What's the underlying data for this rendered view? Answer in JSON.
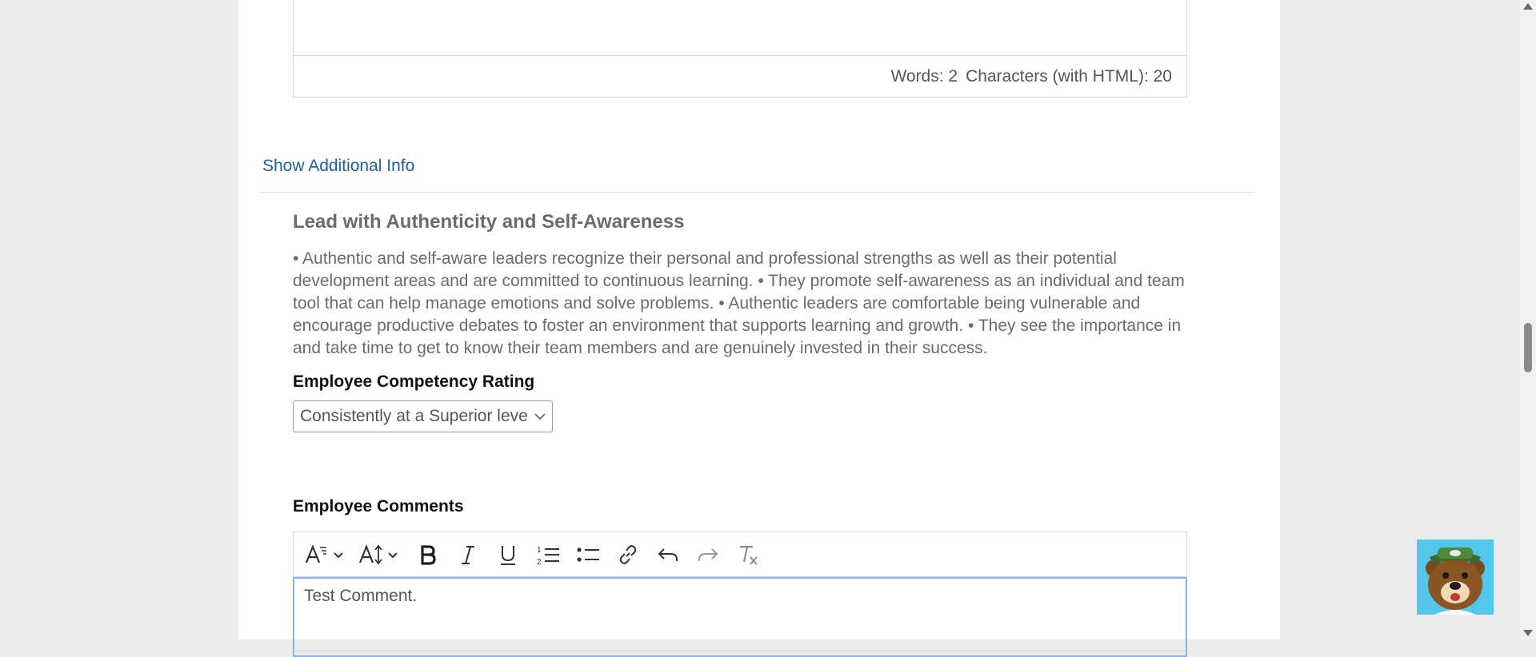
{
  "top_editor": {
    "words_label": "Words: 2",
    "characters_label": "Characters (with HTML): 20"
  },
  "show_additional_info": "Show Additional Info",
  "competency": {
    "title": "Lead with Authenticity and Self-Awareness",
    "description": "• Authentic and self-aware leaders recognize their personal and professional strengths as well as their potential development areas and are committed to continuous learning. • They promote self-awareness as an individual and team tool that can help manage emotions and solve problems. • Authentic leaders are comfortable being vulnerable and encourage productive debates to foster an environment that supports learning and growth. • They see the importance in and take time to get to know their team members and are genuinely invested in their success."
  },
  "rating": {
    "label": "Employee Competency Rating",
    "selected": "Consistently at a Superior level"
  },
  "comments": {
    "label": "Employee Comments",
    "value": "Test Comment."
  },
  "toolbar_icons": [
    "font-family-icon",
    "font-size-icon",
    "bold-icon",
    "italic-icon",
    "underline-icon",
    "numbered-list-icon",
    "bulleted-list-icon",
    "link-icon",
    "undo-icon",
    "redo-icon",
    "clear-formatting-icon"
  ],
  "colors": {
    "link": "#1f5fa0",
    "mascot_bg": "#54c6ec",
    "focus_border": "#8fb3e6"
  }
}
